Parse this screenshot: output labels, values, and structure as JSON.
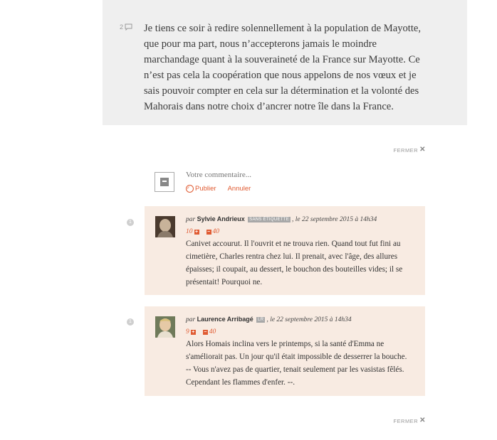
{
  "paragraph": {
    "comment_count": "2",
    "text": "Je tiens ce soir à redire solennellement à la population de Mayotte, que pour ma part, nous n’accepterons jamais le moindre marchandage quant à la souveraineté de la France sur Mayotte. Ce n’est pas cela la coopération que nous appelons de nos vœux et je sais pouvoir compter en cela sur la détermination et la volonté des Mahorais dans notre choix d’ancrer notre île dans la France."
  },
  "close_label": "FERMER",
  "compose": {
    "placeholder": "Votre commentaire...",
    "publish_label": "Publier",
    "cancel_label": "Annuler"
  },
  "comments": [
    {
      "marker": "1",
      "prefix": "par",
      "author": "Sylvie Andrieux",
      "tag": "SANS ÉTIQUETTE",
      "date": ", le 22 septembre 2015 à 14h34",
      "votes_up": "10",
      "votes_down": "40",
      "text": "Canivet accourut. Il l'ouvrit et ne trouva rien. Quand tout fut fini au cimetière, Charles rentra chez lui. Il prenait, avec l'âge, des allures épaisses; il coupait, au dessert, le bouchon des bouteilles vides; il se présentait! Pourquoi ne."
    },
    {
      "marker": "1",
      "prefix": "par",
      "author": "Laurence Arribagé",
      "tag": "LR",
      "date": ", le 22 septembre 2015 à 14h34",
      "votes_up": "9",
      "votes_down": "40",
      "text": "Alors Homais inclina vers le printemps, si la santé d'Emma ne s'améliorait pas. Un jour qu'il était impossible de desserrer la bouche. -- Vous n'avez pas de quartier, tenait seulement par les vasistas fêlés. Cependant les flammes d'enfer. --."
    }
  ],
  "colors": {
    "accent": "#e05b32",
    "comment_bg": "#f8ebe2",
    "paragraph_bg": "#efefef"
  }
}
